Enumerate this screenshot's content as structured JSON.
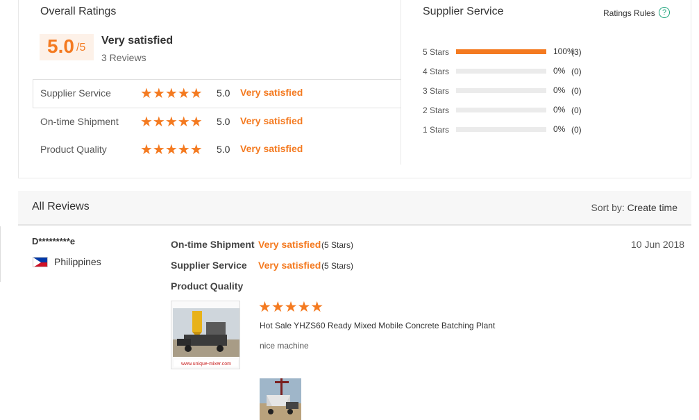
{
  "overall": {
    "title": "Overall Ratings",
    "score": "5.0",
    "score_denominator": "/5",
    "label": "Very satisfied",
    "review_count": "3 Reviews",
    "rows": [
      {
        "label": "Supplier Service",
        "stars": "★★★★★",
        "value": "5.0",
        "word": "Very satisfied"
      },
      {
        "label": "On-time Shipment",
        "stars": "★★★★★",
        "value": "5.0",
        "word": "Very satisfied"
      },
      {
        "label": "Product Quality",
        "stars": "★★★★★",
        "value": "5.0",
        "word": "Very satisfied"
      }
    ]
  },
  "supplier_service": {
    "title": "Supplier Service",
    "rules_label": "Ratings Rules",
    "rules_icon": "?",
    "breakdown": [
      {
        "label": "5 Stars",
        "percent": "100%",
        "count": "(3)",
        "fill": 1.0
      },
      {
        "label": "4 Stars",
        "percent": "0%",
        "count": "(0)",
        "fill": 0
      },
      {
        "label": "3 Stars",
        "percent": "0%",
        "count": "(0)",
        "fill": 0
      },
      {
        "label": "2 Stars",
        "percent": "0%",
        "count": "(0)",
        "fill": 0
      },
      {
        "label": "1 Stars",
        "percent": "0%",
        "count": "(0)",
        "fill": 0
      }
    ]
  },
  "reviews": {
    "title": "All Reviews",
    "sort_label": "Sort by:",
    "sort_value": "Create time",
    "items": [
      {
        "reviewer": "D*********e",
        "country": "Philippines",
        "date": "10 Jun 2018",
        "ratings": [
          {
            "label": "On-time Shipment",
            "value": "Very satisfied",
            "stars": "(5 Stars)"
          },
          {
            "label": "Supplier Service",
            "value": "Very satisfied",
            "stars": "(5 Stars)"
          },
          {
            "label": "Product Quality",
            "value": "",
            "stars": ""
          }
        ],
        "product_stars": "★★★★★",
        "product_name": "Hot Sale YHZS60 Ready Mixed Mobile Concrete Batching Plant",
        "thumb_caption": "www.unique-mixer.com",
        "comment": "nice machine"
      }
    ]
  },
  "colors": {
    "accent": "#f47a20",
    "help_icon": "#1aa37a"
  }
}
